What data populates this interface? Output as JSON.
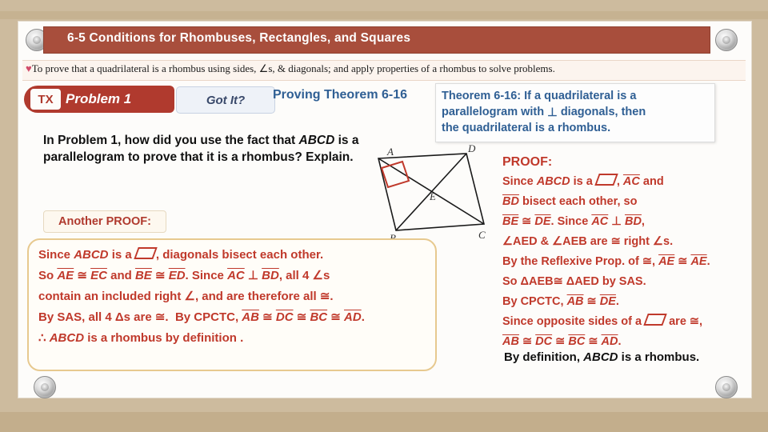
{
  "slide": {
    "title": "6-5 Conditions for Rhombuses, Rectangles, and Squares",
    "objective": "To prove that a quadrilateral is a rhombus using sides, ∠s,  & diagonals; and apply properties of a rhombus to solve problems.",
    "objective_bullet": "♥"
  },
  "badges": {
    "logo": "TX",
    "problem_label": "Problem 1",
    "got_it_label": "Got It?"
  },
  "proving": {
    "title": "Proving Theorem 6-16"
  },
  "question": {
    "line1": "In Problem 1, how did you use the fact that ",
    "abcd": "ABCD",
    "line2": " is a",
    "line3": "parallelogram to prove that it is a rhombus? Explain."
  },
  "theorem": {
    "label": "Theorem 6-16:",
    "text_1": "If a quadrilateral is a",
    "text_2": "parallelogram with",
    "perp": "⊥",
    "text_3": "diagonals, then",
    "text_4": "the quadrilateral is a rhombus."
  },
  "figure": {
    "labels": [
      "A",
      "D",
      "E",
      "B",
      "C"
    ]
  },
  "another_proof": {
    "label": "Another PROOF:"
  },
  "left_proof": {
    "line1_a": "Since ",
    "line1_b": "ABCD",
    "line1_c": " is a ",
    "line1_d": ", diagonals bisect each other.",
    "line2_a": "So ",
    "line2_b": "AE",
    "line2_c": " ≅ ",
    "line2_d": "EC",
    "line2_e": " and ",
    "line2_f": "BE",
    "line2_g": " ≅ ",
    "line2_h": "ED",
    "line2_i": ".   Since ",
    "line2_j": "AC",
    "line2_k": " ⊥ ",
    "line2_l": "BD",
    "line2_m": ",   all 4 ∠s",
    "line3": "contain an included right ∠, and are therefore all ≅.",
    "line4_a": "By SAS, all 4 Δs are ≅.",
    "line4_b": "By CPCTC, ",
    "line4_c": "AB",
    "line4_d": " ≅ ",
    "line4_e": "DC",
    "line4_f": " ≅ ",
    "line4_g": "BC",
    "line4_h": " ≅ ",
    "line4_i": "AD",
    "line4_j": ".",
    "line5_a": "∴ ",
    "line5_b": "ABCD",
    "line5_c": " is a rhombus by definition ."
  },
  "right_proof": {
    "header": "PROOF:",
    "l1_a": "Since ",
    "l1_b": "ABCD",
    "l1_c": " is a ",
    "l1_d": ", ",
    "l1_e": "AC",
    "l1_f": " and",
    "l2_a": "BD",
    "l2_b": " bisect each other, so",
    "l3_a": "BE",
    "l3_b": " ≅ ",
    "l3_c": "DE",
    "l3_d": ". Since ",
    "l3_e": "AC",
    "l3_f": " ⊥ ",
    "l3_g": "BD",
    "l3_h": ",",
    "l4_a": "∠AED & ∠AEB are ≅ right ∠s.",
    "l5_a": "By the Reflexive Prop. of ≅, ",
    "l5_b": "AE",
    "l5_c": " ≅ ",
    "l5_d": "AE",
    "l5_e": ".",
    "l6_a": "So ΔAEB≅ ΔAED by SAS.",
    "l7_a": "By CPCTC, ",
    "l7_b": "AB",
    "l7_c": " ≅ ",
    "l7_d": "DE",
    "l7_e": ".",
    "l8_a": "Since opposite sides of a ",
    "l8_b": " are ≅,",
    "l9_a": "AB",
    "l9_b": " ≅ ",
    "l9_c": "DC",
    "l9_d": " ≅ ",
    "l9_e": "BC",
    "l9_f": " ≅ ",
    "l9_g": "AD",
    "l9_h": "."
  },
  "final": {
    "a": "By definition, ",
    "b": "ABCD",
    "c": " is a rhombus."
  },
  "colors": {
    "title_bar": "#a84e3c",
    "accent_blue": "#2f5f94",
    "proof_red": "#c0392b",
    "slide_bg": "#cdbb9e"
  }
}
